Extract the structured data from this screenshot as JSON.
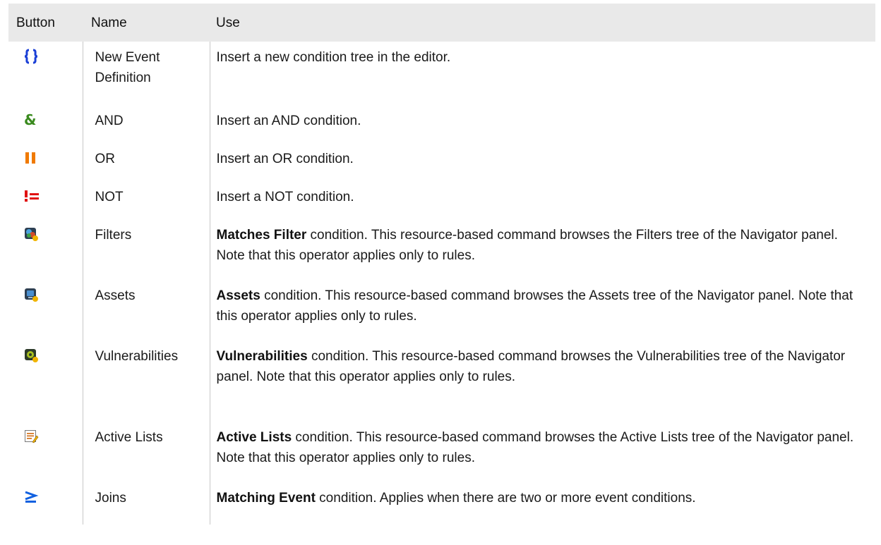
{
  "table": {
    "headers": {
      "button": "Button",
      "name": "Name",
      "use": "Use"
    },
    "rows": [
      {
        "icon": "curly-braces-icon",
        "name": "New Event Definition",
        "use_term": "",
        "use_text": "Insert a new condition tree in the editor."
      },
      {
        "icon": "ampersand-icon",
        "name": "AND",
        "use_term": "",
        "use_text": "Insert an AND condition."
      },
      {
        "icon": "double-bar-icon",
        "name": "OR",
        "use_term": "",
        "use_text": "Insert an OR condition."
      },
      {
        "icon": "not-equal-icon",
        "name": "NOT",
        "use_term": "",
        "use_text": "Insert a NOT condition."
      },
      {
        "icon": "filters-icon",
        "name": "Filters",
        "use_term": "Matches Filter",
        "use_text": " condition. This resource-based command browses the Filters tree of the Navigator panel. Note that this operator applies only to rules."
      },
      {
        "icon": "assets-icon",
        "name": "Assets",
        "use_term": "Assets",
        "use_text": " condition. This resource-based command browses the Assets tree of the Navigator panel. Note that this operator applies only to rules."
      },
      {
        "icon": "vulnerabilities-icon",
        "name": "Vulnerabilities",
        "use_term": "Vulnerabilities",
        "use_text": " condition. This resource-based command browses the Vulnerabilities tree of the Navigator panel. Note that this operator applies only to rules."
      },
      {
        "icon": "active-lists-icon",
        "name": "Active Lists",
        "use_term": "Active Lists",
        "use_text": " condition. This resource-based command browses the Active Lists tree of the Navigator panel. Note that this operator applies only to rules."
      },
      {
        "icon": "joins-icon",
        "name": "Joins",
        "use_term": "Matching Event",
        "use_text": " condition. Applies when there are two or more event conditions."
      }
    ]
  },
  "colors": {
    "header_bg": "#e9e9e9",
    "curly_blue": "#1a3fd6",
    "and_green": "#3a8a1e",
    "or_orange": "#f07a00",
    "not_red": "#e01010",
    "joins_blue": "#1060e0"
  }
}
